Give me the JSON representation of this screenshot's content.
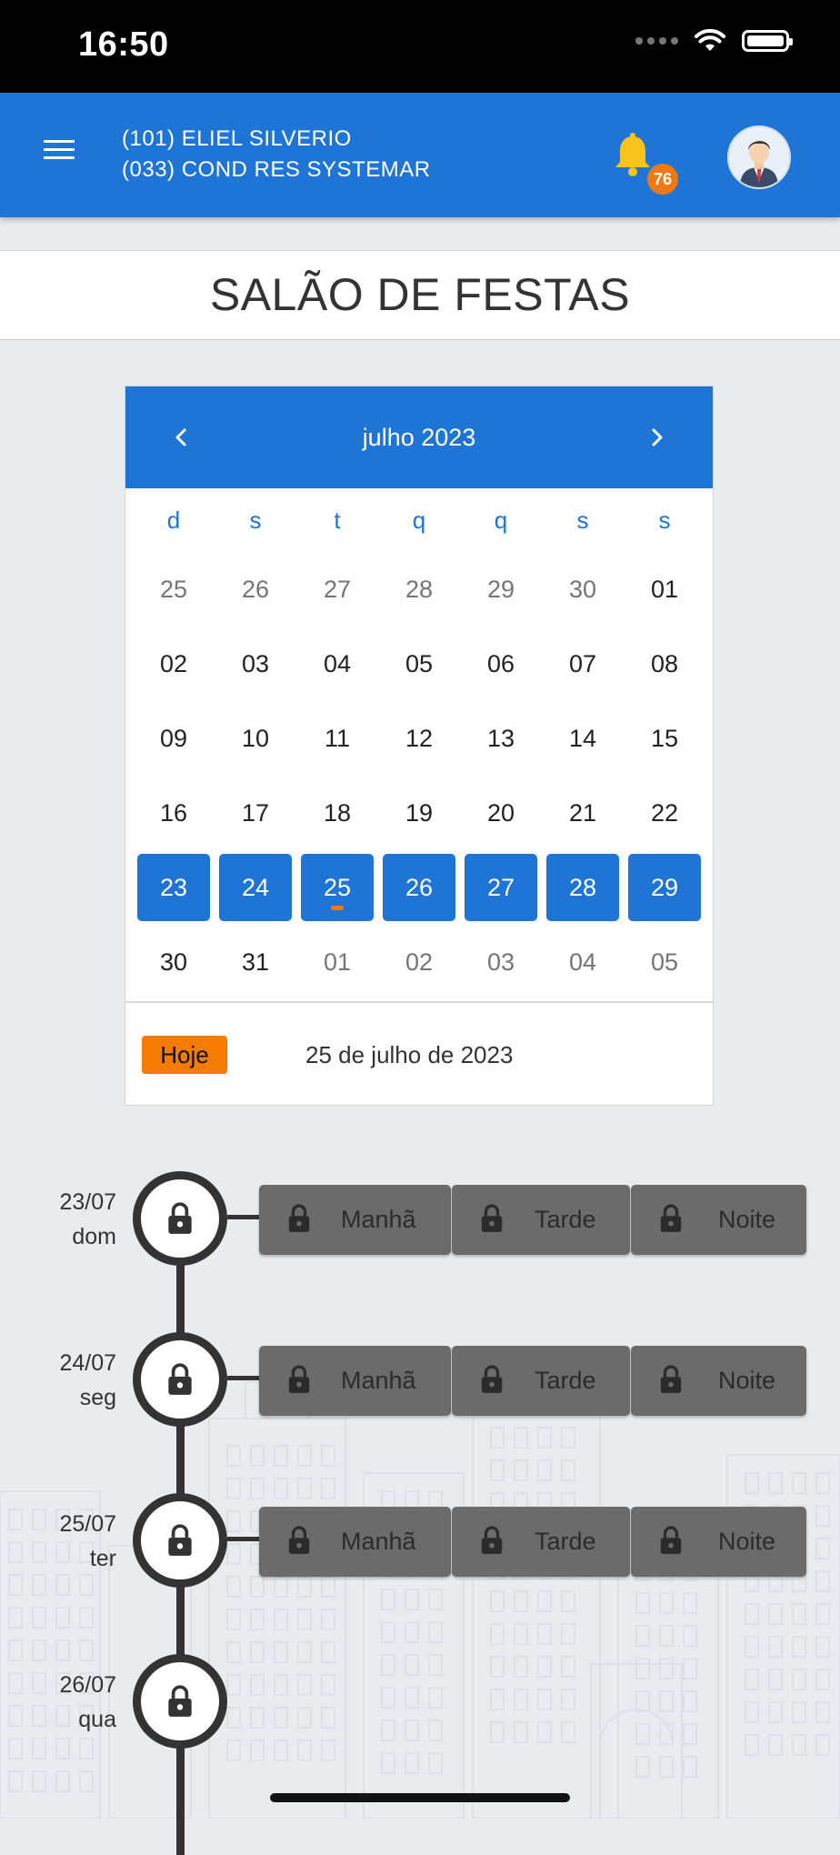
{
  "status_bar": {
    "time": "16:50"
  },
  "header": {
    "user_line1": "(101) ELIEL SILVERIO",
    "user_line2": "(033) COND RES SYSTEMAR",
    "notification_count": "76",
    "accent_color": "#1e75d6",
    "badge_color": "#f07a10"
  },
  "page_title": "SALÃO DE FESTAS",
  "calendar": {
    "month_label": "julho 2023",
    "weekdays": [
      "d",
      "s",
      "t",
      "q",
      "q",
      "s",
      "s"
    ],
    "weeks": [
      [
        {
          "d": "25",
          "o": true
        },
        {
          "d": "26",
          "o": true
        },
        {
          "d": "27",
          "o": true
        },
        {
          "d": "28",
          "o": true
        },
        {
          "d": "29",
          "o": true
        },
        {
          "d": "30",
          "o": true
        },
        {
          "d": "01"
        }
      ],
      [
        {
          "d": "02"
        },
        {
          "d": "03"
        },
        {
          "d": "04"
        },
        {
          "d": "05"
        },
        {
          "d": "06"
        },
        {
          "d": "07"
        },
        {
          "d": "08"
        }
      ],
      [
        {
          "d": "09"
        },
        {
          "d": "10"
        },
        {
          "d": "11"
        },
        {
          "d": "12"
        },
        {
          "d": "13"
        },
        {
          "d": "14"
        },
        {
          "d": "15"
        }
      ],
      [
        {
          "d": "16"
        },
        {
          "d": "17"
        },
        {
          "d": "18"
        },
        {
          "d": "19"
        },
        {
          "d": "20"
        },
        {
          "d": "21"
        },
        {
          "d": "22"
        }
      ],
      [
        {
          "d": "23",
          "s": true
        },
        {
          "d": "24",
          "s": true
        },
        {
          "d": "25",
          "s": true,
          "today": true
        },
        {
          "d": "26",
          "s": true
        },
        {
          "d": "27",
          "s": true
        },
        {
          "d": "28",
          "s": true
        },
        {
          "d": "29",
          "s": true
        }
      ],
      [
        {
          "d": "30"
        },
        {
          "d": "31"
        },
        {
          "d": "01",
          "o": true
        },
        {
          "d": "02",
          "o": true
        },
        {
          "d": "03",
          "o": true
        },
        {
          "d": "04",
          "o": true
        },
        {
          "d": "05",
          "o": true
        }
      ]
    ],
    "today_button": "Hoje",
    "today_text": "25 de julho de 2023"
  },
  "schedule": [
    {
      "date": "23/07",
      "weekday": "dom",
      "slots": [
        "Manhã",
        "Tarde",
        "Noite"
      ],
      "locked": true
    },
    {
      "date": "24/07",
      "weekday": "seg",
      "slots": [
        "Manhã",
        "Tarde",
        "Noite"
      ],
      "locked": true
    },
    {
      "date": "25/07",
      "weekday": "ter",
      "slots": [
        "Manhã",
        "Tarde",
        "Noite"
      ],
      "locked": true
    },
    {
      "date": "26/07",
      "weekday": "qua",
      "slots": [],
      "locked": true
    }
  ]
}
